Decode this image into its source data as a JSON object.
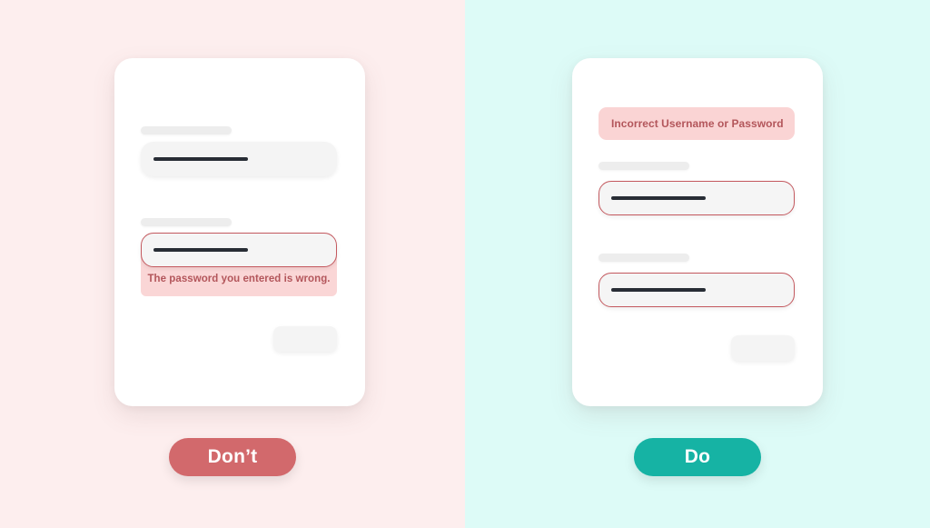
{
  "colors": {
    "left_panel_bg": "#fdeeee",
    "right_panel_bg": "#ddfbf7",
    "card_bg": "#ffffff",
    "field_bg": "#f4f4f4",
    "label_pill": "#ededed",
    "input_bar": "#282d35",
    "error_border": "#c4595f",
    "error_bg": "#fad6d6",
    "error_text": "#b3565b",
    "dont_button": "#d2696c",
    "do_button": "#16b3a4"
  },
  "panels": [
    {
      "id": "dont",
      "background": "#fdeeee",
      "verdict_label": "Don’t",
      "verdict_color": "#d2696c",
      "form": {
        "banner": null,
        "fields": [
          {
            "name": "username",
            "has_label_pill": true,
            "error_state": false,
            "error_message": null
          },
          {
            "name": "password",
            "has_label_pill": true,
            "error_state": true,
            "error_message": "The password you entered is wrong."
          }
        ],
        "submit_button_label": ""
      }
    },
    {
      "id": "do",
      "background": "#ddfbf7",
      "verdict_label": "Do",
      "verdict_color": "#16b3a4",
      "form": {
        "banner": "Incorrect Username or Password",
        "fields": [
          {
            "name": "username",
            "has_label_pill": true,
            "error_state": true,
            "error_message": null
          },
          {
            "name": "password",
            "has_label_pill": true,
            "error_state": true,
            "error_message": null
          }
        ],
        "submit_button_label": ""
      }
    }
  ]
}
